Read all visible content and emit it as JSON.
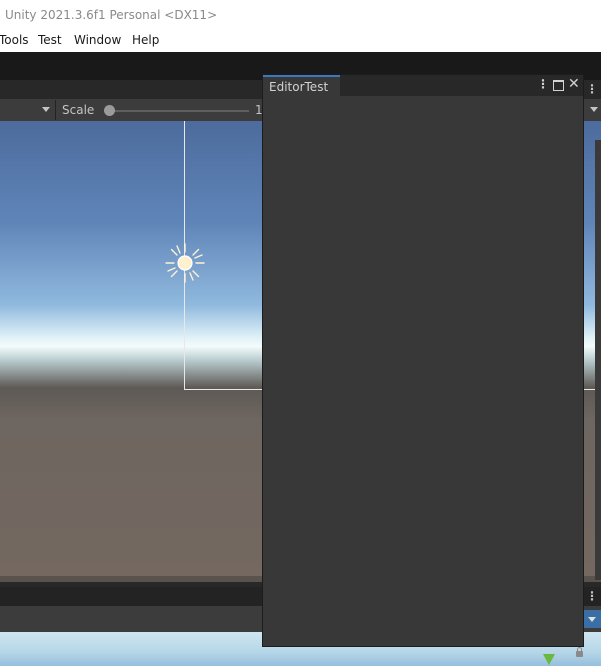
{
  "window": {
    "title": "Unity 2021.3.6f1 Personal <DX11>"
  },
  "menu": {
    "items": [
      "Tools",
      "Test",
      "Window",
      "Help"
    ]
  },
  "game_view": {
    "scale_label": "Scale",
    "scale_value": "1"
  },
  "editor_test": {
    "tab_label": "EditorTest"
  },
  "icons": {
    "sun": "directional-light-sun-icon",
    "kebab": "more-options-icon",
    "maximize": "maximize-icon",
    "close": "close-icon",
    "lock": "lock-icon"
  },
  "colors": {
    "editor_bg": "#383838",
    "toolbar_bg": "#191919",
    "tab_accent": "#3a79bb"
  }
}
